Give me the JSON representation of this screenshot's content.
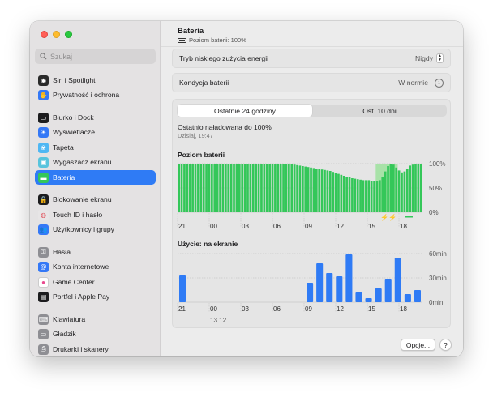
{
  "sidebar": {
    "search_placeholder": "Szukaj",
    "items": [
      {
        "label": "Siri i Spotlight",
        "icon": "siri-icon",
        "color": "#2a2a2a",
        "active": false
      },
      {
        "label": "Prywatność i ochrona",
        "icon": "hand-icon",
        "color": "#3478f6",
        "active": false
      },
      {
        "label": "Biurko i Dock",
        "icon": "dock-icon",
        "color": "#1c1c1e",
        "active": false
      },
      {
        "label": "Wyświetlacze",
        "icon": "sun-icon",
        "color": "#3478f6",
        "active": false
      },
      {
        "label": "Tapeta",
        "icon": "wallpaper-icon",
        "color": "#4fb7f3",
        "active": false
      },
      {
        "label": "Wygaszacz ekranu",
        "icon": "screensaver-icon",
        "color": "#58c4dd",
        "active": false
      },
      {
        "label": "Bateria",
        "icon": "battery-icon",
        "color": "#34c759",
        "active": true
      },
      {
        "label": "Blokowanie ekranu",
        "icon": "lock-icon",
        "color": "#1c1c1e",
        "active": false
      },
      {
        "label": "Touch ID i hasło",
        "icon": "fingerprint-icon",
        "color": "#e7e5e6",
        "active": false
      },
      {
        "label": "Użytkownicy i grupy",
        "icon": "users-icon",
        "color": "#3478f6",
        "active": false
      },
      {
        "label": "Hasła",
        "icon": "key-icon",
        "color": "#8e8e93",
        "active": false
      },
      {
        "label": "Konta internetowe",
        "icon": "at-icon",
        "color": "#3478f6",
        "active": false
      },
      {
        "label": "Game Center",
        "icon": "game-center-icon",
        "color": "#ffffff",
        "active": false
      },
      {
        "label": "Portfel i Apple Pay",
        "icon": "wallet-icon",
        "color": "#1c1c1e",
        "active": false
      },
      {
        "label": "Klawiatura",
        "icon": "keyboard-icon",
        "color": "#8e8e93",
        "active": false
      },
      {
        "label": "Gładzik",
        "icon": "trackpad-icon",
        "color": "#8e8e93",
        "active": false
      },
      {
        "label": "Drukarki i skanery",
        "icon": "printer-icon",
        "color": "#8e8e93",
        "active": false
      }
    ]
  },
  "header": {
    "title": "Bateria",
    "subtitle": "Poziom baterii: 100%"
  },
  "settings": {
    "low_power_label": "Tryb niskiego zużycia energii",
    "low_power_value": "Nigdy",
    "health_label": "Kondycja baterii",
    "health_value": "W normie"
  },
  "tabs": {
    "left": "Ostatnie 24 godziny",
    "right": "Ost. 10 dni"
  },
  "charged": {
    "text": "Ostatnio naładowana do 100%",
    "time": "Dzisiaj, 19:47"
  },
  "buttons": {
    "options": "Opcje...",
    "help": "?"
  },
  "colors": {
    "accent": "#2f7bf5",
    "battery_green": "#34c759",
    "charging_bg": "#a8e2a8",
    "usage_blue": "#2f7bf5"
  },
  "chart_data": [
    {
      "type": "bar",
      "title": "Poziom baterii",
      "x_tick_labels": [
        "21",
        "00",
        "03",
        "06",
        "09",
        "12",
        "15",
        "18"
      ],
      "y_tick_labels": [
        "100%",
        "50%",
        "0%"
      ],
      "ylim": [
        0,
        100
      ],
      "unit": "%",
      "values": [
        100,
        100,
        100,
        100,
        100,
        100,
        100,
        100,
        100,
        100,
        100,
        100,
        100,
        100,
        100,
        100,
        100,
        100,
        100,
        100,
        100,
        100,
        100,
        100,
        100,
        100,
        100,
        100,
        100,
        100,
        100,
        100,
        100,
        100,
        100,
        100,
        100,
        100,
        100,
        100,
        100,
        99,
        98,
        97,
        96,
        95,
        94,
        93,
        92,
        91,
        90,
        89,
        88,
        87,
        86,
        85,
        83,
        81,
        79,
        77,
        75,
        73,
        72,
        70,
        69,
        68,
        67,
        66,
        66,
        66,
        65,
        64,
        64,
        66,
        72,
        84,
        95,
        100,
        98,
        92,
        86,
        82,
        84,
        90,
        96,
        98,
        100,
        100,
        100
      ],
      "charging_from_index": 72,
      "charging_to_index": 80
    },
    {
      "type": "bar",
      "title": "Użycie: na ekranie",
      "x_tick_labels": [
        "21",
        "00",
        "03",
        "06",
        "09",
        "12",
        "15",
        "18"
      ],
      "x_sub_label": "13.12",
      "y_tick_labels": [
        "60min",
        "30min",
        "0min"
      ],
      "ylim": [
        0,
        60
      ],
      "unit": "min",
      "values": [
        33,
        0,
        0,
        0,
        0,
        0,
        0,
        0,
        0,
        0,
        0,
        0,
        0,
        24,
        48,
        36,
        32,
        59,
        12,
        5,
        17,
        29,
        55,
        10,
        15
      ]
    }
  ]
}
